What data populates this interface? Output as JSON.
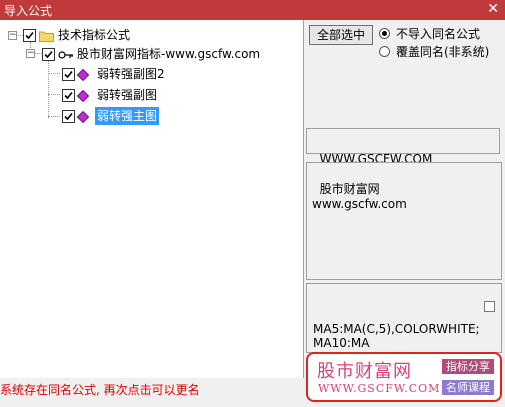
{
  "window": {
    "title": "导入公式",
    "close_glyph": "✕"
  },
  "tree": {
    "root": {
      "label": "技术指标公式",
      "expander": "−"
    },
    "group": {
      "label": "股市财富网指标-www.gscfw.com",
      "expander": "−"
    },
    "items": [
      {
        "label": "弱转强副图2"
      },
      {
        "label": "弱转强副图"
      },
      {
        "label": "弱转强主图"
      }
    ]
  },
  "actions": {
    "select_all": "全部选中"
  },
  "options": {
    "no_import": "不导入同名公式",
    "overwrite": "覆盖同名(非系统)"
  },
  "details": {
    "url": "WWW.GSCFW.COM",
    "description": "股市财富网\nwww.gscfw.com",
    "code": "MA5:MA(C,5),COLORWHITE;\nMA10:MA"
  },
  "status": {
    "message": "系统存在同名公式, 再次点击可以更名"
  },
  "watermark": {
    "name": "股市财富网",
    "url": "WWW.GSCFW.COM",
    "tag1": "指标分享",
    "tag2": "名师课程"
  },
  "colors": {
    "titlebar": "#c0393b",
    "selected": "#3399ff",
    "status": "#e00000",
    "logo": "#d8427a"
  }
}
